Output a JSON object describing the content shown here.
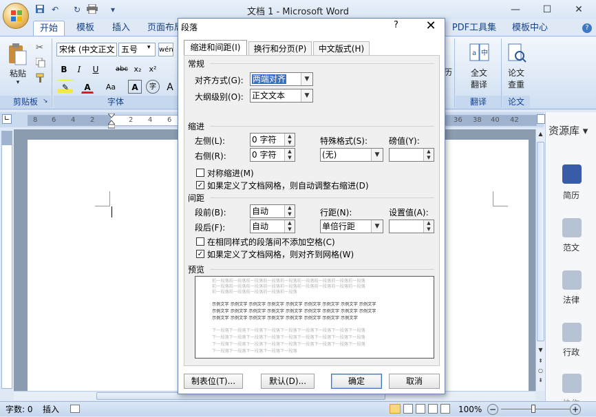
{
  "app": {
    "title": "文档 1 - Microsoft Word",
    "window_controls": {
      "minimize": "—",
      "maximize": "☐",
      "close": "✕"
    },
    "quick_access": {
      "undo": "↶",
      "redo": "↻"
    }
  },
  "ribbon_tabs": [
    "开始",
    "模板",
    "插入",
    "页面布局",
    "PDF工具集",
    "模板中心"
  ],
  "ribbon": {
    "paste_label": "粘贴",
    "clipboard_group": "剪贴板",
    "font_group": "字体",
    "font_name": "宋体 (中文正文",
    "font_size": "五号",
    "format_buttons": {
      "bold": "B",
      "italic": "I",
      "underline": "U",
      "strike": "abc",
      "subscript": "x₂",
      "superscript": "x²",
      "case": "Aa",
      "border": "A",
      "circle": "字",
      "grow": "A"
    },
    "translate_label_1": "全文",
    "translate_label_2": "翻译",
    "translate_group": "翻译",
    "paper_label_1": "论文",
    "paper_label_2": "查重",
    "paper_group": "论文",
    "partial_label": "历"
  },
  "ruler": {
    "ticks": [
      "8",
      "6",
      "4",
      "2",
      "2",
      "4",
      "6",
      "36",
      "38",
      "40",
      "42"
    ]
  },
  "side_panel": {
    "title": "资源库",
    "items": [
      "简历",
      "范文",
      "法律",
      "行政",
      "协作"
    ]
  },
  "statusbar": {
    "word_count": "字数: 0",
    "insert_mode": "插入",
    "zoom": "100%",
    "zoom_minus": "−",
    "zoom_plus": "+"
  },
  "dialog": {
    "title": "段落",
    "help": "?",
    "close": "✕",
    "tabs": [
      "缩进和间距(I)",
      "换行和分页(P)",
      "中文版式(H)"
    ],
    "general": {
      "section": "常规",
      "alignment_label": "对齐方式(G):",
      "alignment_value": "两端对齐",
      "outline_label": "大纲级别(O):",
      "outline_value": "正文文本"
    },
    "indent": {
      "section": "缩进",
      "left_label": "左侧(L):",
      "left_value": "0 字符",
      "right_label": "右侧(R):",
      "right_value": "0 字符",
      "special_label": "特殊格式(S):",
      "special_value": "(无)",
      "by_label": "磅值(Y):",
      "by_value": "",
      "mirror_label": "对称缩进(M)",
      "mirror_checked": false,
      "auto_adjust_label": "如果定义了文档网格，则自动调整右缩进(D)",
      "auto_adjust_checked": true
    },
    "spacing": {
      "section": "间距",
      "before_label": "段前(B):",
      "before_value": "自动",
      "after_label": "段后(F):",
      "after_value": "自动",
      "line_label": "行距(N):",
      "line_value": "单倍行距",
      "at_label": "设置值(A):",
      "at_value": "",
      "no_space_label": "在相同样式的段落间不添加空格(C)",
      "no_space_checked": false,
      "snap_grid_label": "如果定义了文档网格，则对齐到网格(W)",
      "snap_grid_checked": true
    },
    "preview": {
      "section": "预览",
      "prev_lines": [
        "前一段落前一段落前一段落前一段落前一段落前一段落前一段落前一段落前一段落",
        "前一段落前一段落前一段落前一段落前一段落前一段落前一段落前一段落前一段落",
        "前一段落前一段落前一段落前一段落前一段落"
      ],
      "sample_lines": [
        "示例文字 示例文字 示例文字 示例文字 示例文字 示例文字 示例文字 示例文字 示例文字",
        "示例文字 示例文字 示例文字 示例文字 示例文字 示例文字 示例文字 示例文字 示例文字",
        "示例文字 示例文字 示例文字 示例文字 示例文字 示例文字 示例文字 示例文字"
      ],
      "next_lines": [
        "下一段落下一段落下一段落下一段落下一段落下一段落下一段落下一段落下一段落",
        "下一段落下一段落下一段落下一段落下一段落下一段落下一段落下一段落下一段落",
        "下一段落下一段落下一段落下一段落下一段落下一段落下一段落下一段落下一段落",
        "下一段落下一段落下一段落下一段落下一段落"
      ]
    },
    "buttons": {
      "tabs": "制表位(T)...",
      "default": "默认(D)...",
      "ok": "确定",
      "cancel": "取消"
    }
  }
}
